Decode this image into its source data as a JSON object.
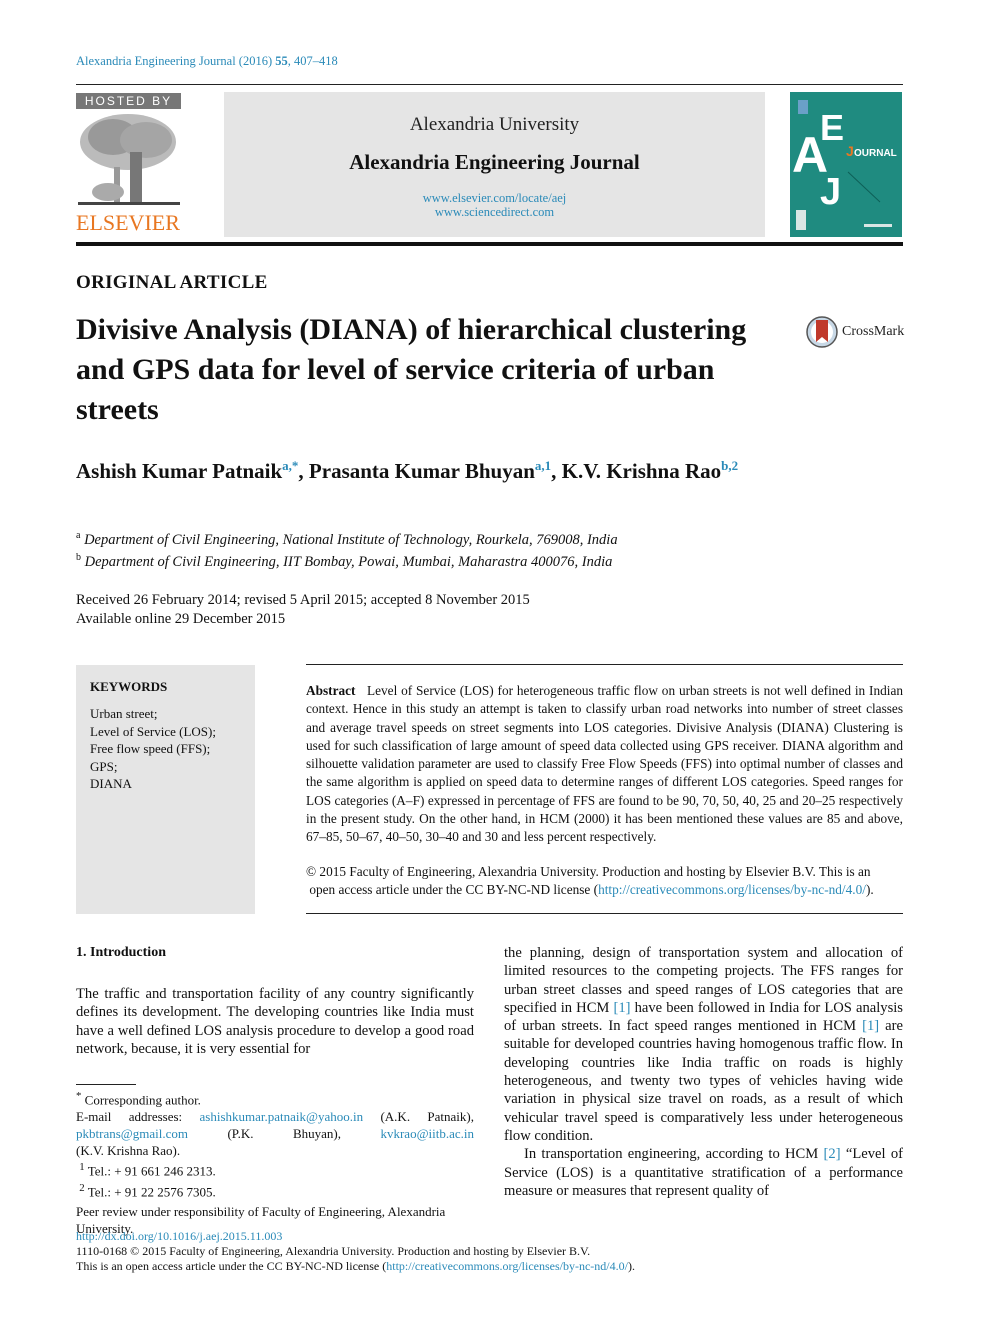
{
  "header": {
    "journal_ref_prefix": "Alexandria Engineering Journal (2016) ",
    "journal_ref_volume": "55",
    "journal_ref_pages": ", 407–418",
    "hosted_by": "HOSTED BY",
    "publisher_logo": "ELSEVIER",
    "university": "Alexandria University",
    "journal_title": "Alexandria Engineering Journal",
    "url_locate": "www.elsevier.com/locate/aej",
    "url_sciencedirect": "www.sciencedirect.com",
    "cover_big_letters": "AEJ",
    "cover_journal_word": "OURNAL",
    "cover_journal_initial": "J",
    "accent_color": "#2a8ab8",
    "elsevier_color": "#e87722",
    "cover_color": "#1f8b80"
  },
  "article": {
    "type": "ORIGINAL ARTICLE",
    "title": "Divisive Analysis (DIANA) of hierarchical clustering and GPS data for level of service criteria of urban streets",
    "crossmark_label": "CrossMark",
    "authors": [
      {
        "name": "Ashish Kumar Patnaik",
        "sup": "a,*"
      },
      {
        "name": "Prasanta Kumar Bhuyan",
        "sup": "a,1"
      },
      {
        "name": "K.V. Krishna Rao",
        "sup": "b,2"
      }
    ],
    "affiliations": [
      {
        "mark": "a",
        "text": "Department of Civil Engineering, National Institute of Technology, Rourkela, 769008, India"
      },
      {
        "mark": "b",
        "text": "Department of Civil Engineering, IIT Bombay, Powai, Mumbai, Maharastra 400076, India"
      }
    ],
    "received": "Received 26 February 2014; revised 5 April 2015; accepted 8 November 2015",
    "available": "Available online 29 December 2015"
  },
  "keywords": {
    "heading": "KEYWORDS",
    "items": [
      "Urban street;",
      "Level of Service (LOS);",
      "Free flow speed (FFS);",
      "GPS;",
      "DIANA"
    ]
  },
  "abstract": {
    "label": "Abstract",
    "text": "Level of Service (LOS) for heterogeneous traffic flow on urban streets is not well defined in Indian context. Hence in this study an attempt is taken to classify urban road networks into number of street classes and average travel speeds on street segments into LOS categories. Divisive Analysis (DIANA) Clustering is used for such classification of large amount of speed data collected using GPS receiver. DIANA algorithm and silhouette validation parameter are used to classify Free Flow Speeds (FFS) into optimal number of classes and the same algorithm is applied on speed data to determine ranges of different LOS categories. Speed ranges for LOS categories (A–F) expressed in percentage of FFS are found to be 90, 70, 50, 40, 25 and 20–25 respectively in the present study. On the other hand, in HCM (2000) it has been mentioned these values are 85 and above, 67–85, 50–67, 40–50, 30–40 and 30 and less percent respectively.",
    "copyright_line1": "© 2015 Faculty of Engineering, Alexandria University. Production and hosting by Elsevier B.V.  This is an",
    "copyright_line2_prefix": "open access article under the CC BY-NC-ND license (",
    "license_url": "http://creativecommons.org/licenses/by-nc-nd/4.0/",
    "copyright_line2_suffix": ")."
  },
  "intro": {
    "heading": "1. Introduction",
    "left_para": "The traffic and transportation facility of any country significantly defines its development. The developing countries like India must have a well defined LOS analysis procedure to develop a good road network, because, it is very essential for",
    "right_p1_a": "the planning, design of transportation system and allocation of limited resources to the competing projects. The FFS ranges for urban street classes and speed ranges of LOS categories that are specified in HCM ",
    "ref1": "[1]",
    "right_p1_b": " have been followed in India for LOS analysis of urban streets. In fact speed ranges mentioned in HCM ",
    "right_p1_c": " are suitable for developed countries having homogenous traffic flow. In developing countries like India traffic on roads is highly heterogeneous, and twenty two types of vehicles having wide variation in physical size travel on roads, as a result of which vehicular travel speed is comparatively less under heterogeneous flow condition.",
    "right_p2_a": "In transportation engineering, according to HCM ",
    "ref2": "[2]",
    "right_p2_b": " “Level of Service (LOS) is a quantitative stratification of a performance measure or measures that represent quality of"
  },
  "footnotes": {
    "corresponding": "Corresponding author.",
    "email_label": "E-mail addresses: ",
    "email1": "ashishkumar.patnaik@yahoo.in",
    "email1_who": " (A.K. Patnaik),",
    "email2": "pkbtrans@gmail.com",
    "email2_who": "(P.K. Bhuyan),",
    "email3": "kvkrao@iitb.ac.in",
    "email3_who": "(K.V. Krishna Rao).",
    "tel1_mark": "1",
    "tel1": "Tel.: + 91 661 246 2313.",
    "tel2_mark": "2",
    "tel2": "Tel.: + 91 22 2576 7305.",
    "peer_review": "Peer review under responsibility of Faculty of Engineering, Alexandria University."
  },
  "bottom": {
    "doi": "http://dx.doi.org/10.1016/j.aej.2015.11.003",
    "issn_line": "1110-0168 © 2015 Faculty of Engineering, Alexandria University. Production and hosting by Elsevier B.V.",
    "oa_prefix": "This is an open access article under the CC BY-NC-ND license (",
    "license_url": "http://creativecommons.org/licenses/by-nc-nd/4.0/",
    "oa_suffix": ")."
  }
}
